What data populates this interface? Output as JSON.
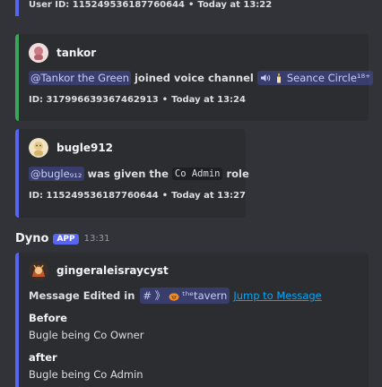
{
  "top_footer": {
    "text": "User ID: 115249536187760644",
    "time": "Today at 13:22"
  },
  "embed1": {
    "author": "tankor",
    "mention": "@Tankor the Green",
    "action": "joined voice channel",
    "channel_icon": "speaker-icon",
    "channel_name": "Seance Circle¹⁸⁺",
    "id_text": "ID: 317996639367462913",
    "time": "Today at 13:24",
    "accent": "#3ba55c"
  },
  "embed2": {
    "author": "bugle912",
    "mention": "@bugle₉₁₂",
    "action": "was given the",
    "role": "Co Admin",
    "role_suffix": "role",
    "id_text": "ID: 115249536187760644",
    "time": "Today at 13:27",
    "accent": "#5865f2"
  },
  "message": {
    "bot_name": "Dyno",
    "badge": "APP",
    "time": "13:31"
  },
  "embed3": {
    "author": "gingeraleisraycyst",
    "edited_label": "Message Edited in",
    "channel_prefix": "# 》",
    "channel_name": "ᵗʰᵉtavern",
    "jump_link": "Jump to Message",
    "before_label": "Before",
    "before_value": "Bugle being Co Owner",
    "after_label": "after",
    "after_value": "Bugle being Co Admin",
    "accent": "#5865f2"
  }
}
